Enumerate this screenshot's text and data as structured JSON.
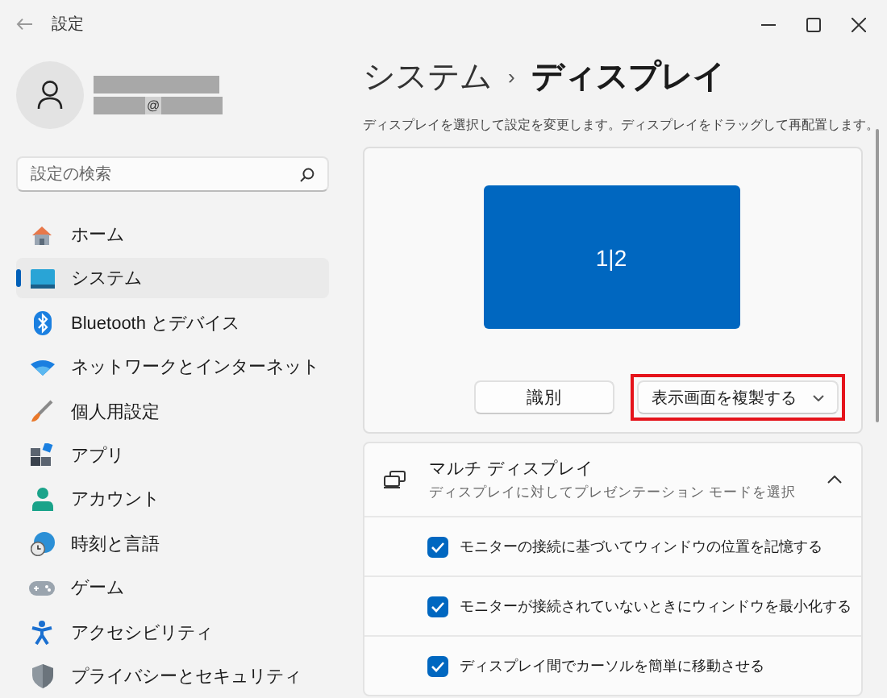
{
  "window": {
    "title": "設定"
  },
  "account": {
    "email_text": "@"
  },
  "search": {
    "placeholder": "設定の検索"
  },
  "nav": [
    {
      "label": "ホーム",
      "selected": false
    },
    {
      "label": "システム",
      "selected": true
    },
    {
      "label": "Bluetooth とデバイス",
      "selected": false
    },
    {
      "label": "ネットワークとインターネット",
      "selected": false
    },
    {
      "label": "個人用設定",
      "selected": false
    },
    {
      "label": "アプリ",
      "selected": false
    },
    {
      "label": "アカウント",
      "selected": false
    },
    {
      "label": "時刻と言語",
      "selected": false
    },
    {
      "label": "ゲーム",
      "selected": false
    },
    {
      "label": "アクセシビリティ",
      "selected": false
    },
    {
      "label": "プライバシーとセキュリティ",
      "selected": false
    }
  ],
  "breadcrumb": {
    "parent": "システム",
    "separator": "›",
    "current": "ディスプレイ"
  },
  "description": "ディスプレイを選択して設定を変更します。ディスプレイをドラッグして再配置します。",
  "arrangement": {
    "monitor_label": "1|2",
    "identify_button": "識別",
    "mode_dropdown": {
      "value": "表示画面を複製する",
      "highlighted": true
    }
  },
  "multi_display": {
    "title": "マルチ ディスプレイ",
    "subtitle": "ディスプレイに対してプレゼンテーション モードを選択",
    "expanded": true,
    "options": [
      {
        "label": "モニターの接続に基づいてウィンドウの位置を記憶する",
        "checked": true
      },
      {
        "label": "モニターが接続されていないときにウィンドウを最小化する",
        "checked": true
      },
      {
        "label": "ディスプレイ間でカーソルを簡単に移動させる",
        "checked": true
      }
    ]
  }
}
